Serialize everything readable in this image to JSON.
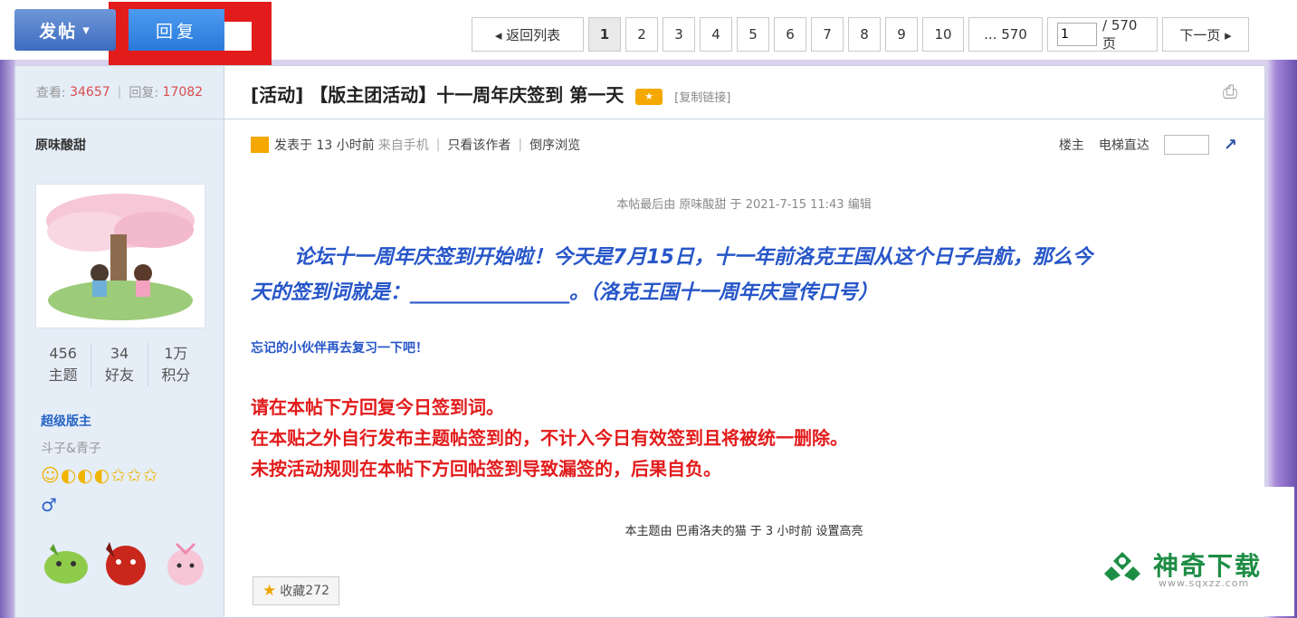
{
  "toolbar": {
    "post_label": "发帖",
    "post_caret": "▾",
    "reply_label": "回复"
  },
  "pager": {
    "back_label": "◂ 返回列表",
    "pages": [
      "1",
      "2",
      "3",
      "4",
      "5",
      "6",
      "7",
      "8",
      "9",
      "10",
      "... 570"
    ],
    "current_page": "1",
    "page_input_value": "1",
    "total_label": "/ 570 页",
    "next_label": "下一页 ▸"
  },
  "thread": {
    "views_label": "查看:",
    "views": "34657",
    "replies_label": "回复:",
    "replies": "17082",
    "title": "[活动] 【版主团活动】十一周年庆签到 第一天",
    "copy_link": "[复制链接]"
  },
  "author": {
    "name": "原味酸甜",
    "topics": "456",
    "topics_label": "主题",
    "friends": "34",
    "friends_label": "好友",
    "points": "1万",
    "points_label": "积分",
    "role": "超级版主",
    "role_sub": "斗子&青子",
    "medals": "☺◐◐◐✩✩✩",
    "gender": "♂"
  },
  "post_meta": {
    "posted": "发表于 13 小时前",
    "source": "来自手机",
    "only_author": "只看该作者",
    "reverse": "倒序浏览",
    "floor": "楼主",
    "elevator": "电梯直达"
  },
  "post": {
    "edited": "本帖最后由 原味酸甜 于 2021-7-15 11:43 编辑",
    "line1": "论坛十一周年庆签到开始啦！今天是7月15日，十一年前洛克王国从这个日子启航，那么今",
    "line2": "天的签到词就是：________________。（洛克王国十一周年庆宣传口号）",
    "reminder": "忘记的小伙伴再去复习一下吧！",
    "red1": "请在本帖下方回复今日签到词。",
    "red2": "在本贴之外自行发布主题帖签到的，不计入今日有效签到且将被统一删除。",
    "red3": "未按活动规则在本帖下方回帖签到导致漏签的，后果自负。",
    "highlight": "本主题由 巴甫洛夫的猫 于 3 小时前 设置高亮",
    "fav_label": "收藏",
    "fav_count": "272"
  },
  "watermark": {
    "name": "神奇下载",
    "url": "www.sqxzz.com"
  },
  "colors": {
    "brand_blue": "#2756c8",
    "alert_red": "#e21b1b",
    "watermark_green": "#1e8d45"
  }
}
